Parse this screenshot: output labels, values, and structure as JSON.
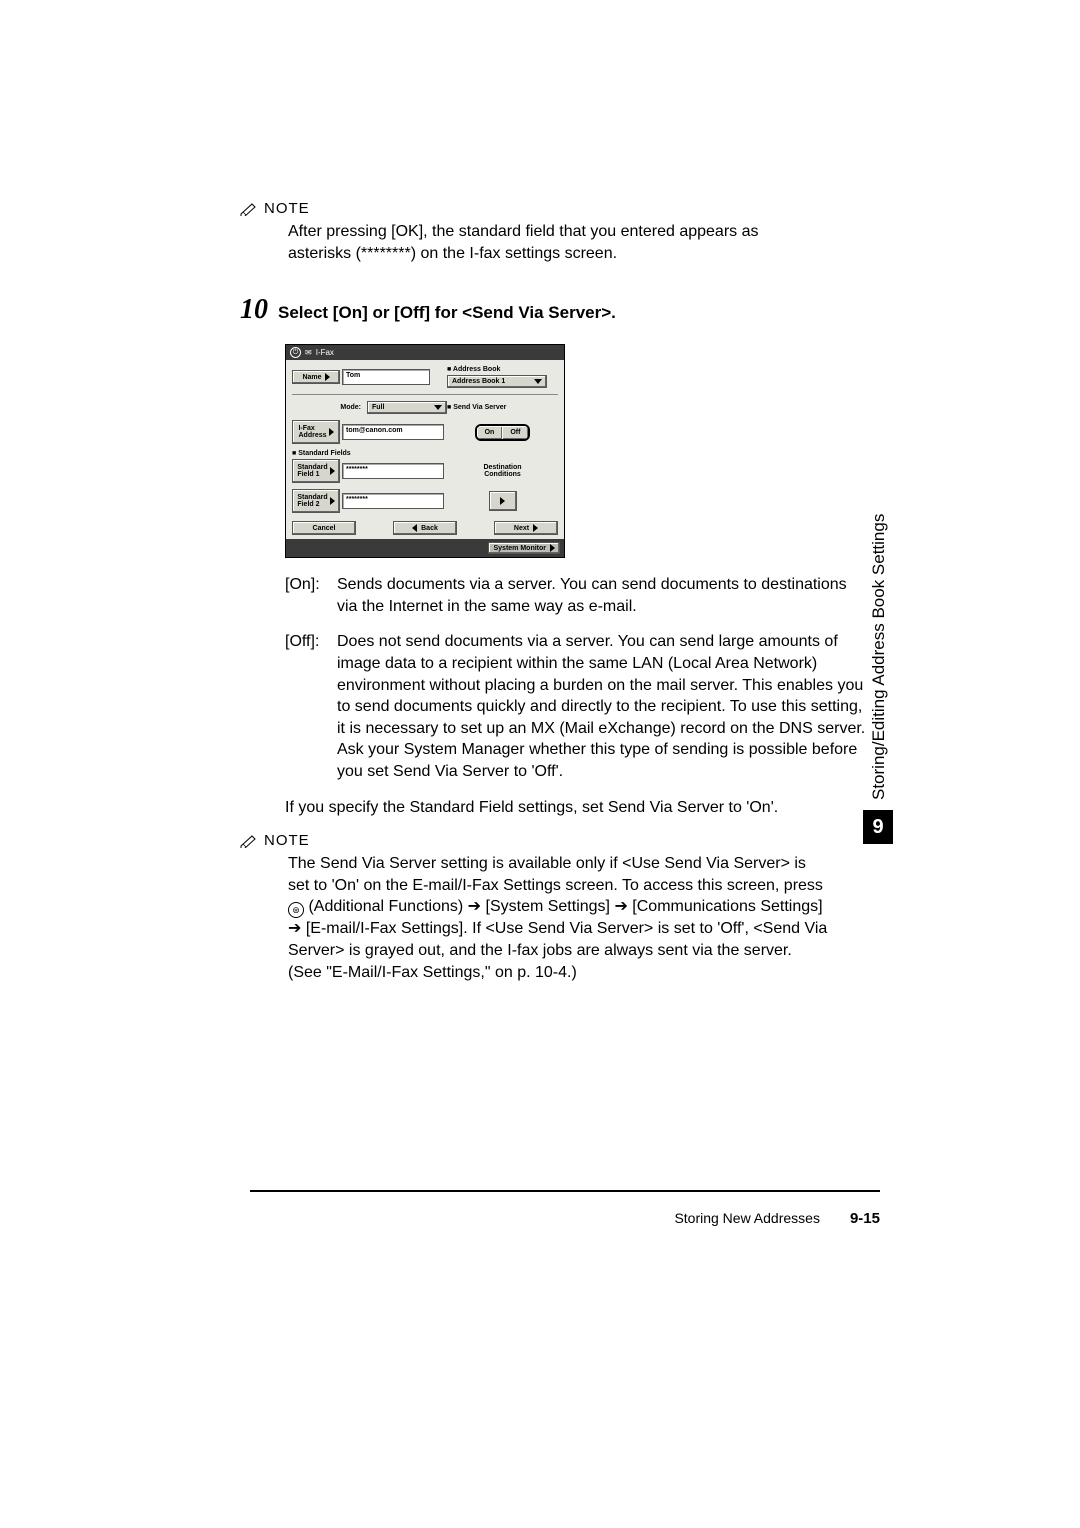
{
  "note1": {
    "label": "NOTE",
    "text": "After pressing [OK], the standard field that you entered appears as asterisks (********) on the I-fax settings screen."
  },
  "step": {
    "number": "10",
    "title": "Select [On] or [Off] for <Send Via Server>."
  },
  "screenshot": {
    "title_mode": "I-Fax",
    "name_label": "Name",
    "name_value": "Tom",
    "addrbook_label": "Address Book",
    "addrbook_value": "Address Book 1",
    "mode_label": "Mode:",
    "mode_value": "Full",
    "sendvia_label": "Send Via Server",
    "on": "On",
    "off": "Off",
    "ifax_label": "I-Fax\nAddress",
    "ifax_value": "tom@canon.com",
    "stdfields_label": "Standard Fields",
    "std1_label": "Standard\nField 1",
    "std1_value": "********",
    "std2_label": "Standard\nField 2",
    "std2_value": "********",
    "dest_label": "Destination\nConditions",
    "cancel": "Cancel",
    "back": "Back",
    "next": "Next",
    "sysmon": "System Monitor"
  },
  "defs": {
    "on_label": "[On]:",
    "on_text": "Sends documents via a server. You can send documents to destinations via the Internet in the same way as e-mail.",
    "off_label": "[Off]:",
    "off_text": "Does not send documents via a server. You can send large amounts of image data to a recipient within the same LAN (Local Area Network) environment without placing a burden on the mail server. This enables you to send documents quickly and directly to the recipient. To use this setting, it is necessary to set up an MX (Mail eXchange) record on the DNS server. Ask your System Manager whether this type of sending is possible before you set Send Via Server to 'Off'."
  },
  "para_std": "If you specify the Standard Field settings, set Send Via Server to 'On'.",
  "note2": {
    "label": "NOTE",
    "text_a": "The Send Via Server setting is available only if <Use Send Via Server> is set to 'On' on the E-mail/I-Fax Settings screen. To access this screen, press ",
    "path1": "(Additional Functions) ",
    "path2": "[System Settings] ",
    "path3": "[Communications Settings] ",
    "path4": "[E-mail/I-Fax Settings]. If <Use Send Via Server> is set to 'Off', <Send Via Server> is grayed out, and the I-fax jobs are always sent via the server. (See \"E-Mail/I-Fax Settings,\" on p. 10-4.)"
  },
  "sidetab": {
    "text": "Storing/Editing Address Book Settings",
    "chapter": "9"
  },
  "footer": {
    "section": "Storing New Addresses",
    "page": "9-15"
  }
}
